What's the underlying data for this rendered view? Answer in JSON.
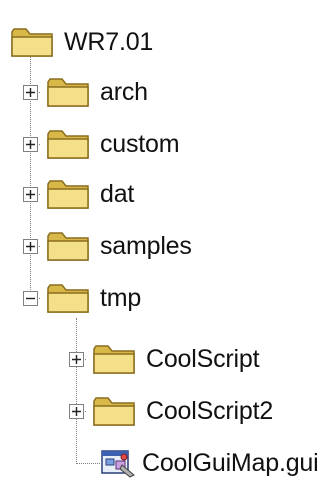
{
  "tree": {
    "root": {
      "label": "WR7.01",
      "icon": "folder-icon"
    },
    "children": [
      {
        "label": "arch",
        "icon": "folder-icon",
        "expander": "plus"
      },
      {
        "label": "custom",
        "icon": "folder-icon",
        "expander": "plus"
      },
      {
        "label": "dat",
        "icon": "folder-icon",
        "expander": "plus"
      },
      {
        "label": "samples",
        "icon": "folder-icon",
        "expander": "plus"
      },
      {
        "label": "tmp",
        "icon": "folder-icon",
        "expander": "minus"
      }
    ],
    "tmp_children": [
      {
        "label": "CoolScript",
        "icon": "folder-icon",
        "expander": "plus"
      },
      {
        "label": "CoolScript2",
        "icon": "folder-icon",
        "expander": "plus"
      },
      {
        "label": "CoolGuiMap.gui",
        "icon": "gui-file-icon"
      }
    ]
  },
  "colors": {
    "folder_fill": "#f5e08a",
    "folder_shade": "#d9b84a",
    "folder_outline": "#8a6d1e",
    "tree_lines": "#808080",
    "text": "#111111"
  }
}
